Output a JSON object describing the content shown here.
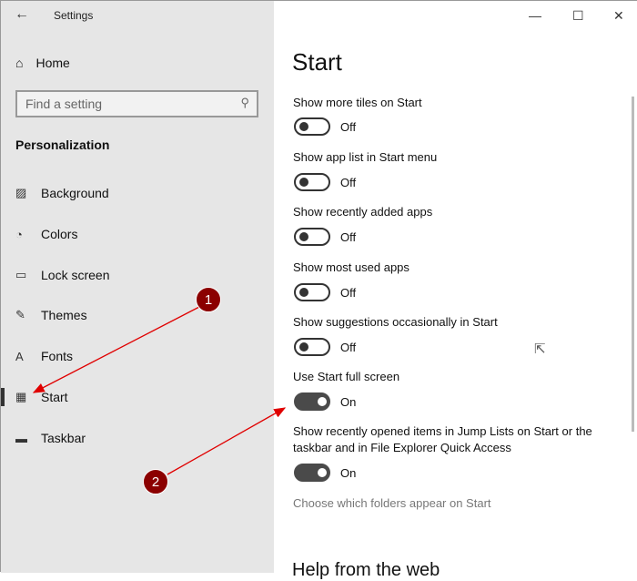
{
  "window": {
    "title": "Settings",
    "back_icon": "back-arrow-icon"
  },
  "sidebar": {
    "home": "Home",
    "search_placeholder": "Find a setting",
    "section": "Personalization",
    "items": [
      {
        "label": "Background",
        "icon": "picture-icon"
      },
      {
        "label": "Colors",
        "icon": "palette-icon"
      },
      {
        "label": "Lock screen",
        "icon": "lock-screen-icon"
      },
      {
        "label": "Themes",
        "icon": "themes-icon"
      },
      {
        "label": "Fonts",
        "icon": "fonts-icon"
      },
      {
        "label": "Start",
        "icon": "start-icon",
        "selected": true
      },
      {
        "label": "Taskbar",
        "icon": "taskbar-icon"
      }
    ]
  },
  "main": {
    "title": "Start",
    "settings": [
      {
        "label": "Show more tiles on Start",
        "state": "Off"
      },
      {
        "label": "Show app list in Start menu",
        "state": "Off"
      },
      {
        "label": "Show recently added apps",
        "state": "Off"
      },
      {
        "label": "Show most used apps",
        "state": "Off"
      },
      {
        "label": "Show suggestions occasionally in Start",
        "state": "Off"
      },
      {
        "label": "Use Start full screen",
        "state": "On"
      },
      {
        "label": "Show recently opened items in Jump Lists on Start or the taskbar and in File Explorer Quick Access",
        "state": "On"
      }
    ],
    "link": "Choose which folders appear on Start",
    "help": "Help from the web"
  },
  "annotations": {
    "one": "1",
    "two": "2",
    "color": "#e00000"
  }
}
